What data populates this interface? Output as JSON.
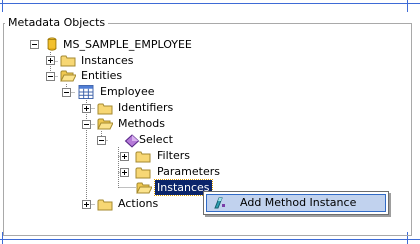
{
  "panel": {
    "title": "Metadata Objects"
  },
  "tree": {
    "root": {
      "label": "MS_SAMPLE_EMPLOYEE",
      "icon": "database-cylinder-icon",
      "expanded": true
    },
    "instances": {
      "label": "Instances",
      "icon": "folder-icon",
      "expanded": false
    },
    "entities": {
      "label": "Entities",
      "icon": "folder-open-icon",
      "expanded": true
    },
    "employee": {
      "label": "Employee",
      "icon": "entity-table-icon",
      "expanded": true
    },
    "identifiers": {
      "label": "Identifiers",
      "icon": "folder-icon",
      "expanded": false
    },
    "methods": {
      "label": "Methods",
      "icon": "folder-open-icon",
      "expanded": true
    },
    "select": {
      "label": "Select",
      "icon": "method-diamond-icon",
      "expanded": true
    },
    "filters": {
      "label": "Filters",
      "icon": "folder-icon",
      "expanded": false
    },
    "parameters": {
      "label": "Parameters",
      "icon": "folder-icon",
      "expanded": false
    },
    "method_instances": {
      "label": "Instances",
      "icon": "folder-open-icon",
      "selected": true
    },
    "actions": {
      "label": "Actions",
      "icon": "folder-icon",
      "expanded": false
    }
  },
  "context_menu": {
    "items": [
      {
        "label": "Add Method Instance",
        "icon": "method-instance-icon",
        "highlighted": true
      }
    ]
  },
  "colors": {
    "selection": "#0a246a",
    "menu_highlight": "#c1d2ee",
    "menu_highlight_border": "#316ac5",
    "frame_accent": "#3e6bd6"
  }
}
